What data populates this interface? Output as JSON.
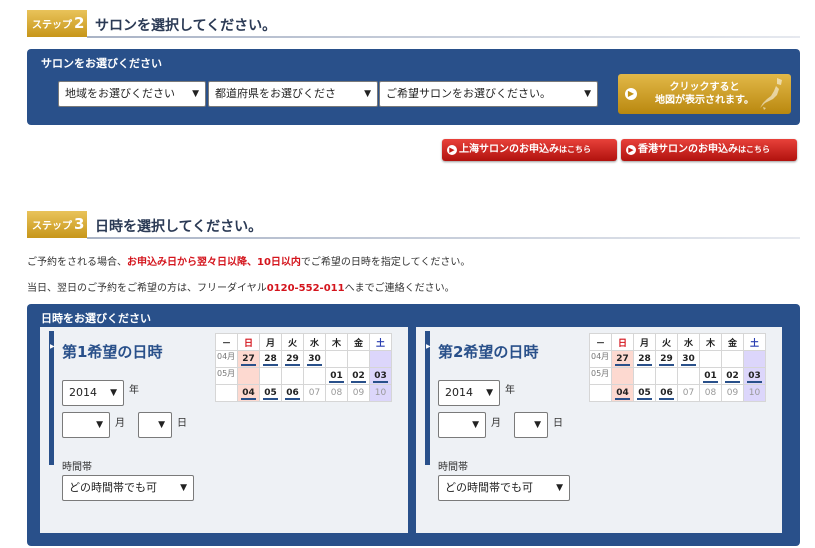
{
  "step2": {
    "badge": "ステップ",
    "badge_num": "2",
    "title": "サロンを選択してください。",
    "box_title": "サロンをお選びください",
    "selects": [
      "地域をお選びください",
      "都道府県をお選びくださ",
      "ご希望サロンをお選びください。"
    ],
    "map_button_line1": "クリックすると",
    "map_button_line2": "地図が表示されます。",
    "shanghai_main": "上海サロンのお申込み",
    "shanghai_small": "はこちら",
    "hongkong_main": "香港サロンのお申込み",
    "hongkong_small": "はこちら"
  },
  "step3": {
    "badge": "ステップ",
    "badge_num": "3",
    "title": "日時を選択してください。",
    "line1_a": "ご予約をされる場合、",
    "line1_b": "お申込み日から翌々日以降、10日以内",
    "line1_c": "でご希望の日時を指定してください。",
    "line2_a": "当日、翌日のご予約をご希望の方は、フリーダイヤル",
    "line2_b": "0120-552-011",
    "line2_c": "へまでご連絡ください。",
    "box_title": "日時をお選びください"
  },
  "panels": [
    {
      "title": "第1希望の日時",
      "year": "2014",
      "year_label": "年",
      "month": "",
      "month_label": "月",
      "day": "",
      "day_label": "日",
      "time_label": "時間帯",
      "time_value": "どの時間帯でも可"
    },
    {
      "title": "第2希望の日時",
      "year": "2014",
      "year_label": "年",
      "month": "",
      "month_label": "月",
      "day": "",
      "day_label": "日",
      "time_label": "時間帯",
      "time_value": "どの時間帯でも可"
    }
  ],
  "calendar": {
    "headers": [
      "－",
      "日",
      "月",
      "火",
      "水",
      "木",
      "金",
      "土"
    ],
    "rows": [
      [
        "04月",
        "27",
        "28",
        "29",
        "30",
        "",
        "",
        ""
      ],
      [
        "05月",
        "",
        "",
        "",
        "",
        "01",
        "02",
        "03"
      ],
      [
        "",
        "04",
        "05",
        "06",
        "07",
        "08",
        "09",
        "10"
      ]
    ],
    "selectable_until_col_in_last_row": 3
  },
  "colors": {
    "navy": "#29508a",
    "gold": "#c7961a",
    "red": "#d4141c"
  }
}
